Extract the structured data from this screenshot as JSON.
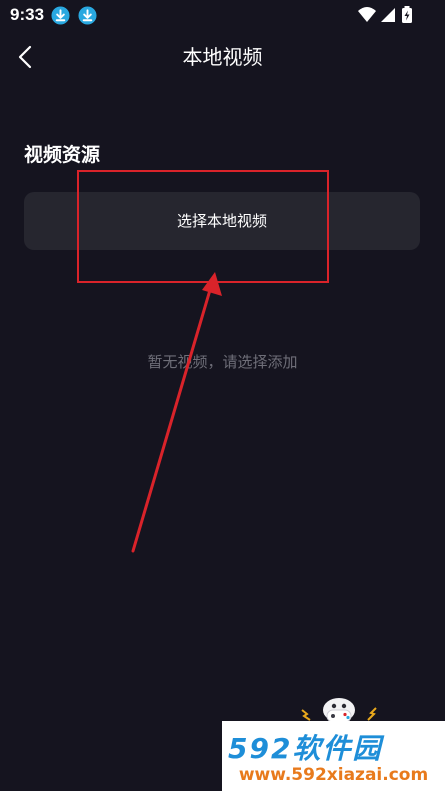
{
  "status_bar": {
    "time": "9:33",
    "icons": [
      "download-icon",
      "download-icon",
      "wifi-icon",
      "signal-icon",
      "battery-charging-icon"
    ]
  },
  "header": {
    "back_icon": "chevron-left-icon",
    "title": "本地视频"
  },
  "section": {
    "title": "视频资源"
  },
  "select_button": {
    "label": "选择本地视频"
  },
  "empty_state": {
    "text": "暂无视频，请选择添加"
  },
  "watermark": {
    "brand": "592软件园",
    "url": "www.592xiazai.com"
  },
  "colors": {
    "background": "#15141f",
    "button_bg": "#26262f",
    "annotation": "#d9232a",
    "download_badge": "#29a8e0",
    "watermark_blue": "#1e8ed8",
    "watermark_orange": "#e87a1c"
  }
}
